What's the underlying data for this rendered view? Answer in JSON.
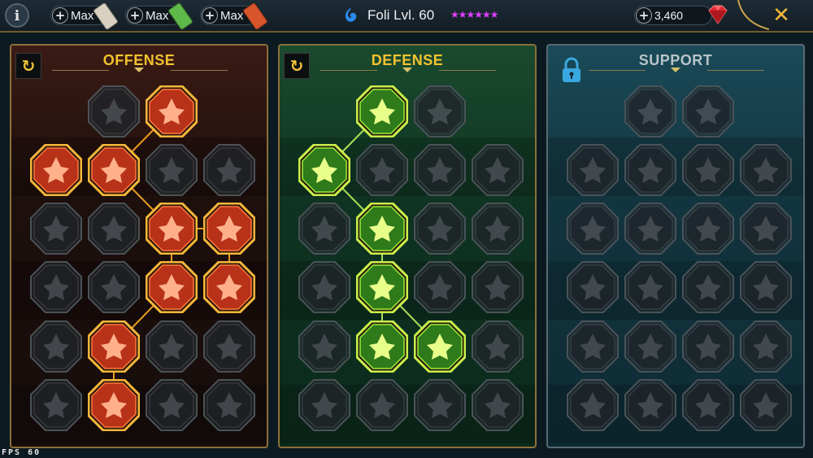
{
  "topbar": {
    "info_label": "i",
    "resources": [
      {
        "label": "Max",
        "plus": "+",
        "item_color": "#d8d0c0",
        "item_name": "scroll-icon"
      },
      {
        "label": "Max",
        "plus": "+",
        "item_color": "#5fb84a",
        "item_name": "scroll-icon"
      },
      {
        "label": "Max",
        "plus": "+",
        "item_color": "#d8542a",
        "item_name": "scroll-icon"
      }
    ],
    "hero_name": "Foli Lvl. 60",
    "stars": "★★★★★★",
    "gems_plus": "+",
    "gems_value": "3,460",
    "close_label": "✕"
  },
  "panels": {
    "offense": {
      "title": "OFFENSE",
      "reset_label": "↻"
    },
    "defense": {
      "title": "DEFENSE",
      "reset_label": "↻"
    },
    "support": {
      "title": "SUPPORT"
    }
  },
  "colors": {
    "offense_active": "#ff6a28",
    "offense_border": "#f5b73a",
    "defense_active": "#9ae22c",
    "defense_border": "#c8f04a",
    "inactive": "#3a3f44",
    "gold": "#f2c230"
  },
  "nodes": {
    "offense": [
      {
        "row": 0,
        "col": 1,
        "icon": "crossed-swords-icon",
        "active": false
      },
      {
        "row": 0,
        "col": 2,
        "icon": "blade-strike-icon",
        "active": true
      },
      {
        "row": 1,
        "col": 0,
        "icon": "horned-demon-icon",
        "active": true
      },
      {
        "row": 1,
        "col": 1,
        "icon": "sword-flurry-icon",
        "active": true
      },
      {
        "row": 1,
        "col": 2,
        "icon": "shield-arrow-icon",
        "active": false
      },
      {
        "row": 1,
        "col": 3,
        "icon": "heart-shield-icon",
        "active": false
      },
      {
        "row": 2,
        "col": 0,
        "icon": "warrior-icon",
        "active": false
      },
      {
        "row": 2,
        "col": 1,
        "icon": "fangs-icon",
        "active": false
      },
      {
        "row": 2,
        "col": 2,
        "icon": "skull-slash-icon",
        "active": true
      },
      {
        "row": 2,
        "col": 3,
        "icon": "fist-sickle-icon",
        "active": true
      },
      {
        "row": 3,
        "col": 0,
        "icon": "sword-heart-icon",
        "active": false
      },
      {
        "row": 3,
        "col": 1,
        "icon": "fist-icon",
        "active": false
      },
      {
        "row": 3,
        "col": 2,
        "icon": "axe-icon",
        "active": true
      },
      {
        "row": 3,
        "col": 3,
        "icon": "chain-lightning-icon",
        "active": true
      },
      {
        "row": 4,
        "col": 0,
        "icon": "claw-icon",
        "active": false
      },
      {
        "row": 4,
        "col": 1,
        "icon": "triple-skull-icon",
        "active": true
      },
      {
        "row": 4,
        "col": 2,
        "icon": "blade-ring-icon",
        "active": false
      },
      {
        "row": 4,
        "col": 3,
        "icon": "berserker-icon",
        "active": false
      },
      {
        "row": 5,
        "col": 0,
        "icon": "sword-sparkle-icon",
        "active": false
      },
      {
        "row": 5,
        "col": 1,
        "icon": "flaming-helm-icon",
        "active": true
      },
      {
        "row": 5,
        "col": 2,
        "icon": "demon-wings-icon",
        "active": false
      },
      {
        "row": 5,
        "col": 3,
        "icon": "skull-crown-icon",
        "active": false
      }
    ],
    "defense": [
      {
        "row": 0,
        "col": 1,
        "icon": "armor-plates-icon",
        "active": true
      },
      {
        "row": 0,
        "col": 2,
        "icon": "raised-fist-icon",
        "active": false
      },
      {
        "row": 1,
        "col": 0,
        "icon": "chevron-shield-icon",
        "active": true
      },
      {
        "row": 1,
        "col": 1,
        "icon": "heart-hand-icon",
        "active": false
      },
      {
        "row": 1,
        "col": 2,
        "icon": "armored-knight-icon",
        "active": false
      },
      {
        "row": 1,
        "col": 3,
        "icon": "sword-parry-icon",
        "active": false
      },
      {
        "row": 2,
        "col": 0,
        "icon": "guardian-icon",
        "active": false
      },
      {
        "row": 2,
        "col": 1,
        "icon": "knight-shield-icon",
        "active": true
      },
      {
        "row": 2,
        "col": 2,
        "icon": "heart-icon",
        "active": false
      },
      {
        "row": 2,
        "col": 3,
        "icon": "hooded-skull-icon",
        "active": false
      },
      {
        "row": 3,
        "col": 0,
        "icon": "crowd-icon",
        "active": false
      },
      {
        "row": 3,
        "col": 1,
        "icon": "hourglass-icon",
        "active": true
      },
      {
        "row": 3,
        "col": 2,
        "icon": "open-palm-icon",
        "active": false
      },
      {
        "row": 3,
        "col": 3,
        "icon": "bull-icon",
        "active": false
      },
      {
        "row": 4,
        "col": 0,
        "icon": "dash-runner-icon",
        "active": false
      },
      {
        "row": 4,
        "col": 1,
        "icon": "spiked-drops-icon",
        "active": true
      },
      {
        "row": 4,
        "col": 2,
        "icon": "sun-skull-icon",
        "active": true
      },
      {
        "row": 4,
        "col": 3,
        "icon": "spear-icon",
        "active": false
      },
      {
        "row": 5,
        "col": 0,
        "icon": "phoenix-icon",
        "active": false
      },
      {
        "row": 5,
        "col": 1,
        "icon": "tower-shield-icon",
        "active": false
      },
      {
        "row": 5,
        "col": 2,
        "icon": "bearded-face-icon",
        "active": false
      },
      {
        "row": 5,
        "col": 3,
        "icon": "strongman-icon",
        "active": false
      }
    ],
    "support": [
      {
        "row": 0,
        "col": 1,
        "icon": "heart-plus-icon",
        "active": false
      },
      {
        "row": 0,
        "col": 2,
        "icon": "swirl-eye-icon",
        "active": false
      },
      {
        "row": 1,
        "col": 0,
        "icon": "praying-hands-icon",
        "active": false
      },
      {
        "row": 1,
        "col": 1,
        "icon": "shield-wave-icon",
        "active": false
      },
      {
        "row": 1,
        "col": 2,
        "icon": "skull-burst-icon",
        "active": false
      },
      {
        "row": 1,
        "col": 3,
        "icon": "speed-arrows-icon",
        "active": false
      },
      {
        "row": 2,
        "col": 0,
        "icon": "healer-icon",
        "active": false
      },
      {
        "row": 2,
        "col": 1,
        "icon": "lightning-icon",
        "active": false
      },
      {
        "row": 2,
        "col": 2,
        "icon": "river-icon",
        "active": false
      },
      {
        "row": 2,
        "col": 3,
        "icon": "person-icon",
        "active": false
      },
      {
        "row": 3,
        "col": 0,
        "icon": "chained-heart-icon",
        "active": false
      },
      {
        "row": 3,
        "col": 1,
        "icon": "comet-icon",
        "active": false
      },
      {
        "row": 3,
        "col": 2,
        "icon": "spellbook-icon",
        "active": false
      },
      {
        "row": 3,
        "col": 3,
        "icon": "angry-eyes-icon",
        "active": false
      },
      {
        "row": 4,
        "col": 0,
        "icon": "compass-star-icon",
        "active": false
      },
      {
        "row": 4,
        "col": 1,
        "icon": "boot-icon",
        "active": false
      },
      {
        "row": 4,
        "col": 2,
        "icon": "eye-icon",
        "active": false
      },
      {
        "row": 4,
        "col": 3,
        "icon": "dancer-icon",
        "active": false
      },
      {
        "row": 5,
        "col": 0,
        "icon": "potion-icon",
        "active": false
      },
      {
        "row": 5,
        "col": 1,
        "icon": "skull-icon",
        "active": false
      },
      {
        "row": 5,
        "col": 2,
        "icon": "fist-strike-icon",
        "active": false
      },
      {
        "row": 5,
        "col": 3,
        "icon": "eagle-icon",
        "active": false
      }
    ]
  },
  "links": {
    "offense": [
      [
        0,
        2,
        1,
        1
      ],
      [
        1,
        1,
        2,
        2
      ],
      [
        2,
        2,
        2,
        3
      ],
      [
        2,
        2,
        3,
        2
      ],
      [
        2,
        3,
        3,
        3
      ],
      [
        3,
        2,
        4,
        1
      ],
      [
        4,
        1,
        5,
        1
      ]
    ],
    "defense": [
      [
        0,
        1,
        1,
        0
      ],
      [
        1,
        0,
        2,
        1
      ],
      [
        2,
        1,
        3,
        1
      ],
      [
        3,
        1,
        4,
        1
      ],
      [
        3,
        1,
        4,
        2
      ]
    ]
  },
  "fps": "FPS   60"
}
